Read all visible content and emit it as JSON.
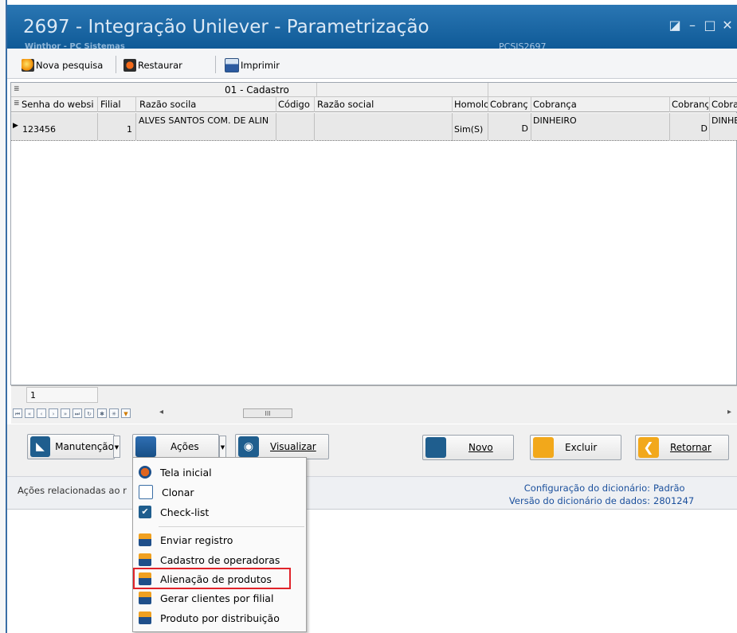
{
  "window": {
    "title": "2697 - Integração Unilever - Parametrização",
    "subtitle": "Winthor - PC Sistemas",
    "program_id": "PCSIS2697",
    "buttons": [
      "restore",
      "minimize",
      "maximize",
      "close"
    ]
  },
  "toolbar": {
    "items": [
      {
        "label": "Nova pesquisa",
        "icon": "search-icon"
      },
      {
        "label": "Restaurar",
        "icon": "restore-icon"
      },
      {
        "label": "Imprimir",
        "icon": "printer-icon"
      }
    ]
  },
  "grid": {
    "band_label": "01 - Cadastro",
    "columns": [
      "Senha do websi",
      "Filial",
      "Razão socila",
      "Código",
      "Razão social",
      "Homolo",
      "Cobranç",
      "Cobrança",
      "Cobranç",
      "Cobra"
    ],
    "rows": [
      [
        "123456",
        "1",
        "ALVES SANTOS COM. DE ALIN",
        "",
        "",
        "Sim(S)",
        "D",
        "DINHEIRO",
        "D",
        "DINHE"
      ]
    ],
    "footer_count": "1",
    "scroll_mark": "III"
  },
  "actions": {
    "manutencao": "Manutenção",
    "acoes": "Ações",
    "visualizar": "Visualizar",
    "novo": "Novo",
    "excluir": "Excluir",
    "retornar": "Retornar"
  },
  "status": {
    "left_text": "Ações relacionadas ao r",
    "config_label": "Configuração do dicionário:",
    "config_value": "Padrão",
    "version_label": "Versão do dicionário de dados:",
    "version_value": "2801247"
  },
  "menu": {
    "group1": [
      {
        "label": "Tela inicial",
        "icon": "home-icon"
      },
      {
        "label": "Clonar",
        "icon": "copy-icon"
      },
      {
        "label": "Check-list",
        "icon": "checkbox-icon"
      }
    ],
    "group2": [
      {
        "label": "Enviar registro",
        "icon": "folder-icon"
      },
      {
        "label": "Cadastro de operadoras",
        "icon": "folder-icon"
      },
      {
        "label": "Alienação de produtos",
        "icon": "folder-icon",
        "highlighted": true
      },
      {
        "label": "Gerar clientes por filial",
        "icon": "folder-icon"
      },
      {
        "label": "Produto por distribuição",
        "icon": "folder-icon"
      }
    ]
  },
  "colors": {
    "title_bar": "#1a66a6",
    "highlight_border": "#e0232a",
    "status_text": "#1a4f9c"
  }
}
